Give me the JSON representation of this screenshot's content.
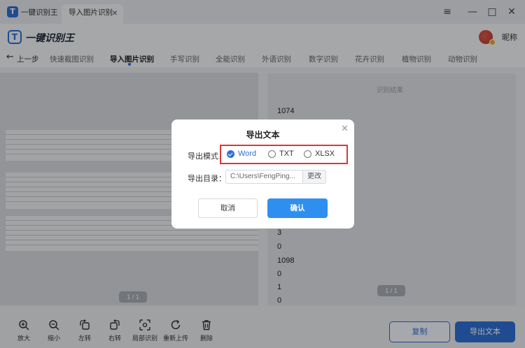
{
  "titlebar": {
    "home_tab": "一键识别王",
    "active_tab": "导入图片识别",
    "close_glyph": "×",
    "window_buttons": {
      "menu": "≡",
      "minimize": "—",
      "maximize": "□",
      "close": "✕"
    }
  },
  "header": {
    "logo_letter": "T",
    "brand": "一键识别王",
    "nickname": "昵称"
  },
  "nav": {
    "back_label": "上一步",
    "items": [
      "快速截图识别",
      "导入图片识别",
      "手写识别",
      "全能识别",
      "外语识别",
      "数字识别",
      "花卉识别",
      "植物识别",
      "动物识别"
    ],
    "active_index": 1
  },
  "left_panel": {
    "page_indicator": "1 / 1"
  },
  "right_panel": {
    "title": "识别结果",
    "page_indicator": "1 / 1",
    "lines_top": [
      "1074"
    ],
    "lines_bottom": [
      "3",
      "0",
      "1098",
      "0",
      "1",
      "0"
    ]
  },
  "toolbar": {
    "tools": [
      {
        "label": "放大",
        "icon": "zoom-in-icon"
      },
      {
        "label": "缩小",
        "icon": "zoom-out-icon"
      },
      {
        "label": "左转",
        "icon": "rotate-left-icon"
      },
      {
        "label": "右转",
        "icon": "rotate-right-icon"
      },
      {
        "label": "局部识别",
        "icon": "partial-recognize-icon"
      },
      {
        "label": "重新上传",
        "icon": "reupload-icon"
      },
      {
        "label": "删除",
        "icon": "trash-icon"
      }
    ],
    "copy_label": "复制",
    "export_label": "导出文本"
  },
  "dialog": {
    "title": "导出文本",
    "mode_label": "导出模式：",
    "modes": [
      {
        "label": "Word",
        "checked": true
      },
      {
        "label": "TXT",
        "checked": false
      },
      {
        "label": "XLSX",
        "checked": false
      }
    ],
    "dir_label": "导出目录：",
    "dir_value": "C:\\Users\\FengPing...",
    "change_label": "更改",
    "cancel_label": "取消",
    "confirm_label": "确认"
  },
  "colors": {
    "accent": "#2f6fd6",
    "confirm": "#2f8ff0",
    "highlight_border": "#d93a33"
  }
}
